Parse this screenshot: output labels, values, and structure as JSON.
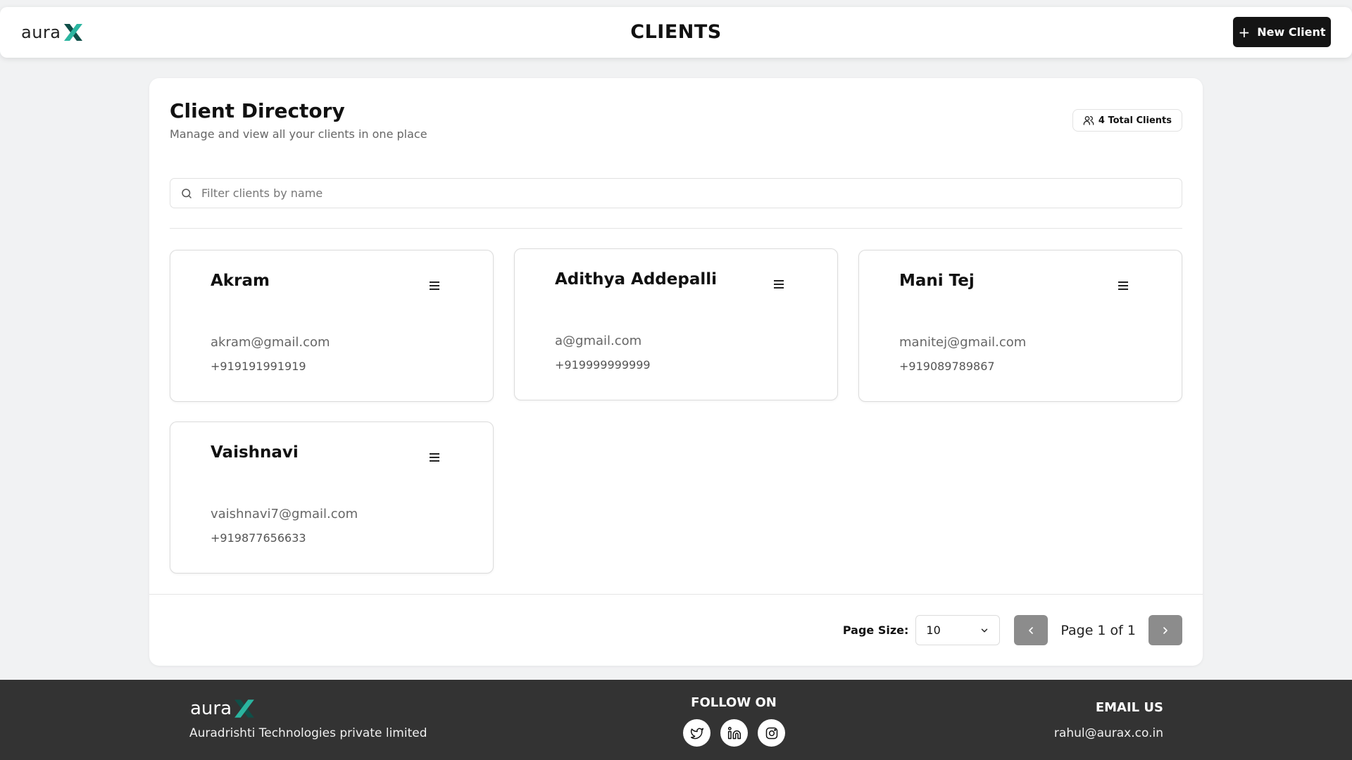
{
  "header": {
    "logo_text": "aura",
    "logo_mark": "X",
    "title": "CLIENTS",
    "new_client_label": "New Client"
  },
  "directory": {
    "title": "Client Directory",
    "subtitle": "Manage and view all your clients in one place",
    "total_badge": "4 Total Clients",
    "search_placeholder": "Filter clients by name"
  },
  "clients": [
    {
      "name": "Akram",
      "email": "akram@gmail.com",
      "phone": "+919191991919"
    },
    {
      "name": "Adithya Addepalli",
      "email": "a@gmail.com",
      "phone": "+919999999999"
    },
    {
      "name": "Mani Tej",
      "email": "manitej@gmail.com",
      "phone": "+919089789867"
    },
    {
      "name": "Vaishnavi",
      "email": "vaishnavi7@gmail.com",
      "phone": "+919877656633"
    }
  ],
  "pagination": {
    "page_size_label": "Page Size:",
    "page_size_value": "10",
    "page_text": "Page 1 of 1"
  },
  "footer": {
    "logo_text": "aura",
    "logo_mark": "X",
    "company": "Auradrishti Technologies private limited",
    "follow_title": "FOLLOW ON",
    "socials": [
      "twitter-icon",
      "linkedin-icon",
      "instagram-icon"
    ],
    "email_title": "EMAIL US",
    "email": "rahul@aurax.co.in"
  },
  "colors": {
    "accent_dark": "#141414",
    "logo_teal": "#1a9a8a",
    "footer_bg": "#333333",
    "nav_button_bg": "#8c8c8c"
  }
}
